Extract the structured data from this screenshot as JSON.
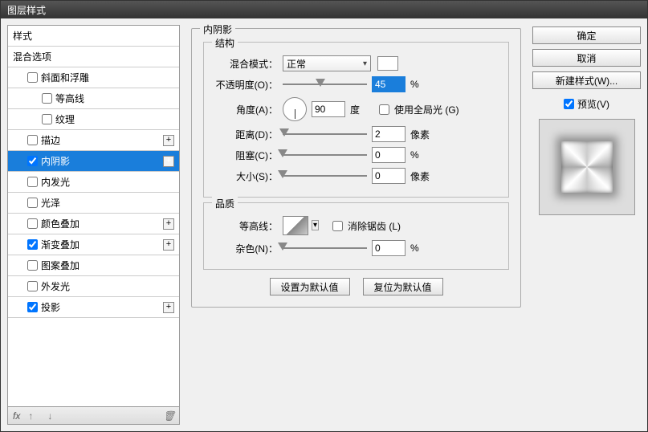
{
  "window": {
    "title": "图层样式"
  },
  "left": {
    "styles_header": "样式",
    "blend_options": "混合选项",
    "bevel_emboss": "斜面和浮雕",
    "contour": "等高线",
    "texture": "纹理",
    "stroke": "描边",
    "inner_shadow": "内阴影",
    "inner_glow": "内发光",
    "satin": "光泽",
    "color_overlay": "颜色叠加",
    "gradient_overlay": "渐变叠加",
    "pattern_overlay": "图案叠加",
    "outer_glow": "外发光",
    "drop_shadow": "投影",
    "footer_fx": "fx"
  },
  "center": {
    "panel_title": "内阴影",
    "structure": "结构",
    "blend_mode_label": "混合模式：",
    "blend_mode_value": "正常",
    "opacity_label": "不透明度(O)：",
    "opacity_value": "45",
    "opacity_unit": "%",
    "angle_label": "角度(A)：",
    "angle_value": "90",
    "angle_unit": "度",
    "use_global_light": "使用全局光 (G)",
    "distance_label": "距离(D)：",
    "distance_value": "2",
    "distance_unit": "像素",
    "choke_label": "阻塞(C)：",
    "choke_value": "0",
    "choke_unit": "%",
    "size_label": "大小(S)：",
    "size_value": "0",
    "size_unit": "像素",
    "quality": "品质",
    "contour_label": "等高线：",
    "antialias": "消除锯齿 (L)",
    "noise_label": "杂色(N)：",
    "noise_value": "0",
    "noise_unit": "%",
    "set_default": "设置为默认值",
    "reset_default": "复位为默认值"
  },
  "right": {
    "ok": "确定",
    "cancel": "取消",
    "new_style": "新建样式(W)...",
    "preview": "预览(V)"
  }
}
